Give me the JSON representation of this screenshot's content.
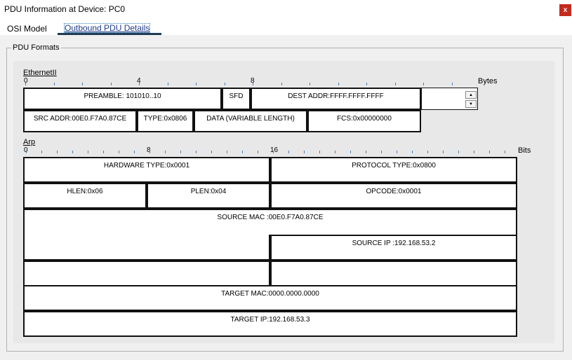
{
  "window": {
    "title": "PDU Information at Device: PC0",
    "close_label": "x"
  },
  "tabs": [
    {
      "label": "OSI Model"
    },
    {
      "label": "Outbound PDU Details"
    }
  ],
  "group": {
    "label": "PDU Formats"
  },
  "ethernet": {
    "label": "EthernetII",
    "ruler": {
      "labels": [
        "0",
        "4",
        "8"
      ],
      "unit": "Bytes"
    },
    "fields": {
      "preamble": "PREAMBLE: 101010..10",
      "sfd": "SFD",
      "dest": "DEST ADDR:FFFF.FFFF.FFFF",
      "src": "SRC ADDR:00E0.F7A0.87CE",
      "type": "TYPE:0x0806",
      "data": "DATA (VARIABLE LENGTH)",
      "fcs": "FCS:0x00000000"
    }
  },
  "arp": {
    "label": "Arp",
    "ruler": {
      "labels": [
        "0",
        "8",
        "16"
      ],
      "unit": "Bits"
    },
    "fields": {
      "hardware_type": "HARDWARE TYPE:0x0001",
      "protocol_type": "PROTOCOL TYPE:0x0800",
      "hlen": "HLEN:0x06",
      "plen": "PLEN:0x04",
      "opcode": "OPCODE:0x0001",
      "source_mac": "SOURCE MAC :00E0.F7A0.87CE",
      "source_ip": "SOURCE IP :192.168.53.2",
      "target_mac": "TARGET MAC:0000.0000.0000",
      "target_ip": "TARGET IP:192.168.53.3"
    }
  }
}
